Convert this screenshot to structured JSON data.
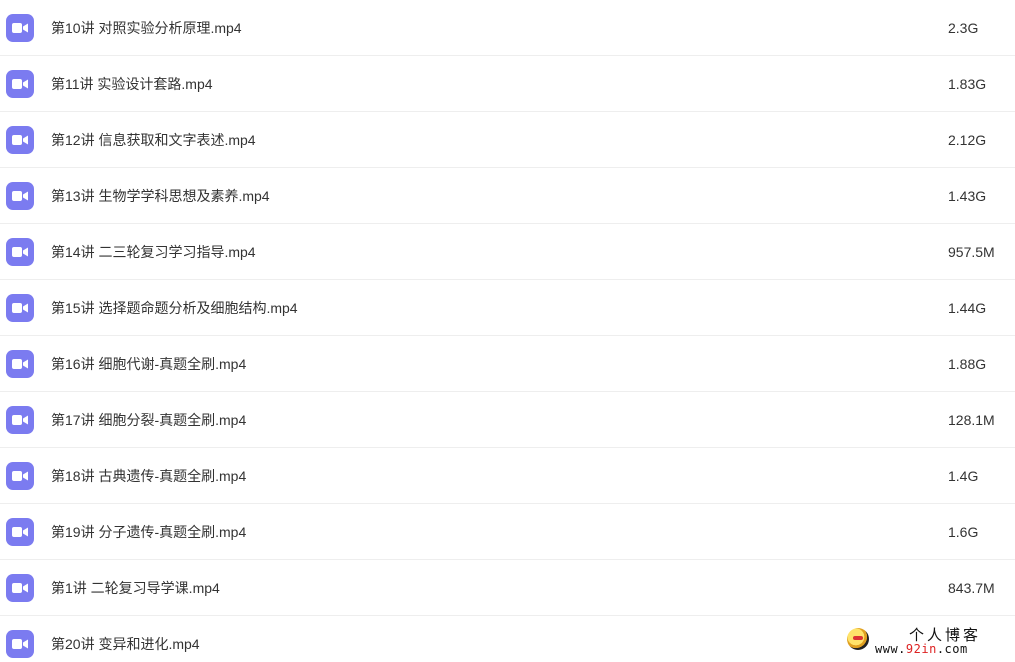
{
  "files": [
    {
      "name": "第10讲 对照实验分析原理.mp4",
      "size": "2.3G",
      "icon": "video-icon"
    },
    {
      "name": "第11讲 实验设计套路.mp4",
      "size": "1.83G",
      "icon": "video-icon"
    },
    {
      "name": "第12讲 信息获取和文字表述.mp4",
      "size": "2.12G",
      "icon": "video-icon"
    },
    {
      "name": "第13讲 生物学学科思想及素养.mp4",
      "size": "1.43G",
      "icon": "video-icon"
    },
    {
      "name": "第14讲 二三轮复习学习指导.mp4",
      "size": "957.5M",
      "icon": "video-icon"
    },
    {
      "name": "第15讲 选择题命题分析及细胞结构.mp4",
      "size": "1.44G",
      "icon": "video-icon"
    },
    {
      "name": "第16讲 细胞代谢-真题全刷.mp4",
      "size": "1.88G",
      "icon": "video-icon"
    },
    {
      "name": "第17讲 细胞分裂-真题全刷.mp4",
      "size": "128.1M",
      "icon": "video-icon"
    },
    {
      "name": "第18讲 古典遗传-真题全刷.mp4",
      "size": "1.4G",
      "icon": "video-icon"
    },
    {
      "name": "第19讲 分子遗传-真题全刷.mp4",
      "size": "1.6G",
      "icon": "video-icon"
    },
    {
      "name": "第1讲 二轮复习导学课.mp4",
      "size": "843.7M",
      "icon": "video-icon"
    },
    {
      "name": "第20讲 变异和进化.mp4",
      "size": "",
      "icon": "video-icon"
    }
  ],
  "watermark": {
    "title": "个人博客",
    "url_prefix": "www.",
    "url_accent": "92in",
    "url_suffix": ".com"
  },
  "colors": {
    "icon_bg": "#7b7bf0",
    "text": "#333333",
    "divider": "#eeeeee",
    "watermark_accent": "#dd2222"
  }
}
